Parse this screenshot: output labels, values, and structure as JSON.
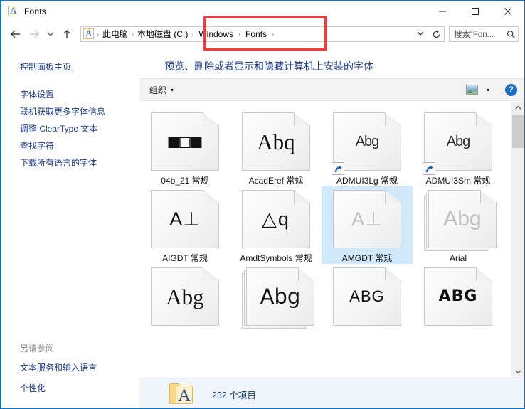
{
  "window": {
    "title": "Fonts",
    "icon": "font-file-icon",
    "controls": {
      "minimize": "minimize-icon",
      "maximize": "maximize-icon",
      "close": "close-icon"
    }
  },
  "addressbar": {
    "back": "back-arrow-icon",
    "forward": "forward-arrow-icon",
    "recent": "recent-locations-chevron-icon",
    "up": "up-arrow-icon",
    "crumbs": [
      "此电脑",
      "本地磁盘 (C:)",
      "Windows",
      "Fonts"
    ],
    "separator": "›",
    "dropdown": "address-dropdown-icon",
    "refresh": "refresh-icon",
    "search_placeholder": "搜索“Fon...",
    "search_value": "",
    "search_icon": "magnifier-icon"
  },
  "annotation": {
    "color": "#f73939",
    "shape": "rectangle",
    "target": "breadcrumb-windows-fonts"
  },
  "sidebar": {
    "home": "控制面板主页",
    "items": [
      "字体设置",
      "联机获取更多字体信息",
      "调整 ClearType 文本",
      "查找字符",
      "下载所有语言的字体"
    ],
    "see_also_header": "另请参阅",
    "see_also": [
      "文本服务和输入语言",
      "个性化"
    ]
  },
  "main": {
    "page_title": "预览、删除或者显示和隐藏计算机上安装的字体",
    "toolbar": {
      "organize": "组织",
      "organize_caret": "▾",
      "view_icon": "preview-pane-icon",
      "view_caret": "▾",
      "help": "?"
    },
    "fonts": [
      [
        {
          "name": "04b_21 常规",
          "glyph": "■□■",
          "style": "pixel",
          "shortcut": false,
          "stack": false,
          "selected": false,
          "dim": false
        },
        {
          "name": "AcadEref 常规",
          "glyph": "Abq",
          "style": "serif-lt",
          "shortcut": false,
          "stack": false,
          "selected": false,
          "dim": false
        },
        {
          "name": "ADMUI3Lg 常规",
          "glyph": "Abg",
          "style": "cond",
          "shortcut": true,
          "stack": false,
          "selected": false,
          "dim": false
        },
        {
          "name": "ADMUI3Sm 常规",
          "glyph": "Abg",
          "style": "cond",
          "shortcut": true,
          "stack": false,
          "selected": false,
          "dim": false
        }
      ],
      [
        {
          "name": "AIGDT 常规",
          "glyph": "A⊥",
          "style": "tech",
          "shortcut": false,
          "stack": false,
          "selected": false,
          "dim": false
        },
        {
          "name": "AmdtSymbols 常规",
          "glyph": "△q",
          "style": "symbol",
          "shortcut": false,
          "stack": false,
          "selected": false,
          "dim": false
        },
        {
          "name": "AMGDT 常规",
          "glyph": "A⊥",
          "style": "tech",
          "shortcut": false,
          "stack": false,
          "selected": true,
          "dim": true
        },
        {
          "name": "Arial",
          "glyph": "Abg",
          "style": "sans",
          "shortcut": false,
          "stack": true,
          "selected": false,
          "dim": true
        }
      ],
      [
        {
          "name": "",
          "glyph": "Abg",
          "style": "serif-lt",
          "shortcut": false,
          "stack": false,
          "selected": false,
          "dim": false
        },
        {
          "name": "",
          "glyph": "Abg",
          "style": "hand",
          "shortcut": false,
          "stack": true,
          "selected": false,
          "dim": false
        },
        {
          "name": "",
          "glyph": "ABG",
          "style": "smallcap",
          "shortcut": false,
          "stack": false,
          "selected": false,
          "dim": false
        },
        {
          "name": "",
          "glyph": "ABG",
          "style": "smallcapb",
          "shortcut": false,
          "stack": false,
          "selected": false,
          "dim": false
        }
      ]
    ],
    "scrollbar": {
      "up": "scroll-up-arrow",
      "down": "scroll-down-arrow",
      "position": "near-top"
    }
  },
  "statusbar": {
    "icon": "fonts-folder-icon",
    "count_text": "232 个项目"
  }
}
